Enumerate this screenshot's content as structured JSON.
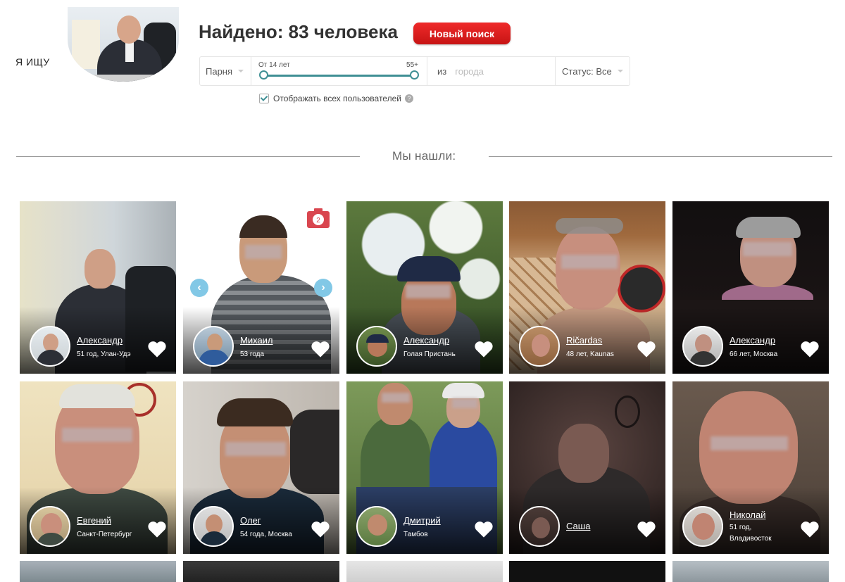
{
  "search_label": "Я ИЩУ",
  "header": {
    "found_text": "Найдено: 83 человека",
    "new_search_label": "Новый поиск"
  },
  "filters": {
    "gender_value": "Парня",
    "age_from_label": "От 14 лет",
    "age_to_label": "55+",
    "city_prefix": "из",
    "city_placeholder": "города",
    "status_value": "Статус: Все"
  },
  "show_all_label": "Отображать всех пользователей",
  "section_title": "Мы нашли:",
  "cards": [
    {
      "name": "Александр",
      "meta": "51 год, Улан-Удэ"
    },
    {
      "name": "Михаил",
      "meta": "53 года",
      "photo_count": "2"
    },
    {
      "name": "Александр",
      "meta": "Голая Пристань"
    },
    {
      "name": "Ričardas",
      "meta": "48 лет, Kaunas"
    },
    {
      "name": "Александр",
      "meta": "66 лет, Москва"
    },
    {
      "name": "Евгений",
      "meta": "Санкт-Петербург"
    },
    {
      "name": "Олег",
      "meta": "54 года, Москва"
    },
    {
      "name": "Дмитрий",
      "meta": "Тамбов"
    },
    {
      "name": "Саша",
      "meta": ""
    },
    {
      "name": "Николай",
      "meta": "51 год,",
      "meta2": "Владивосток"
    }
  ],
  "colors": {
    "accent": "#3f8f94",
    "button_red": "#d81e1e",
    "carousel_arrow": "#82c8e6",
    "photo_badge": "#d9464f"
  }
}
